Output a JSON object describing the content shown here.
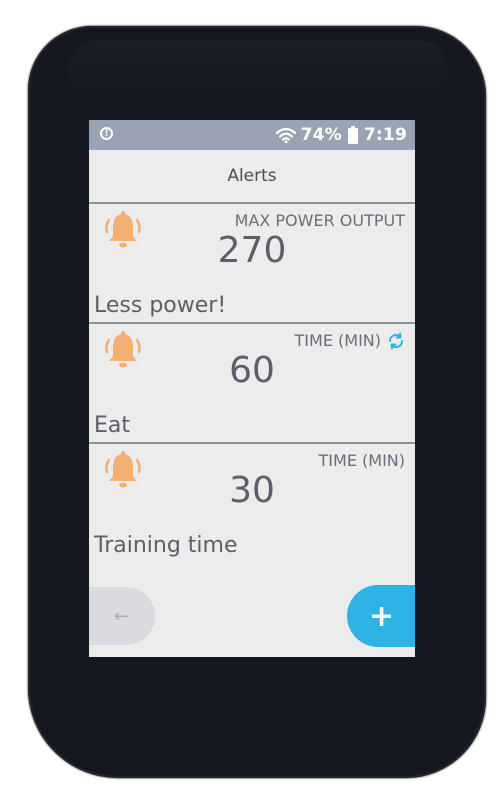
{
  "status": {
    "battery": "74%",
    "time": "7:19",
    "bar_color": "#9aa3b4"
  },
  "header": {
    "title": "Alerts"
  },
  "alerts": [
    {
      "label": "MAX POWER OUTPUT",
      "value": "270",
      "desc": "Less power!",
      "icon": "bell-icon",
      "repeat_icon": null
    },
    {
      "label": "TIME (MIN)",
      "value": "60",
      "desc": "Eat",
      "icon": "bell-icon",
      "repeat_icon": "repeat-icon"
    },
    {
      "label": "TIME (MIN)",
      "value": "30",
      "desc": "Training time",
      "icon": "bell-icon",
      "repeat_icon": null
    }
  ],
  "footer": {
    "back_label": "←",
    "add_label": "+"
  },
  "colors": {
    "accent": "#2cb2e3",
    "bell": "#f0b173",
    "text": "#5c5f69",
    "divider": "#8a92a2"
  }
}
